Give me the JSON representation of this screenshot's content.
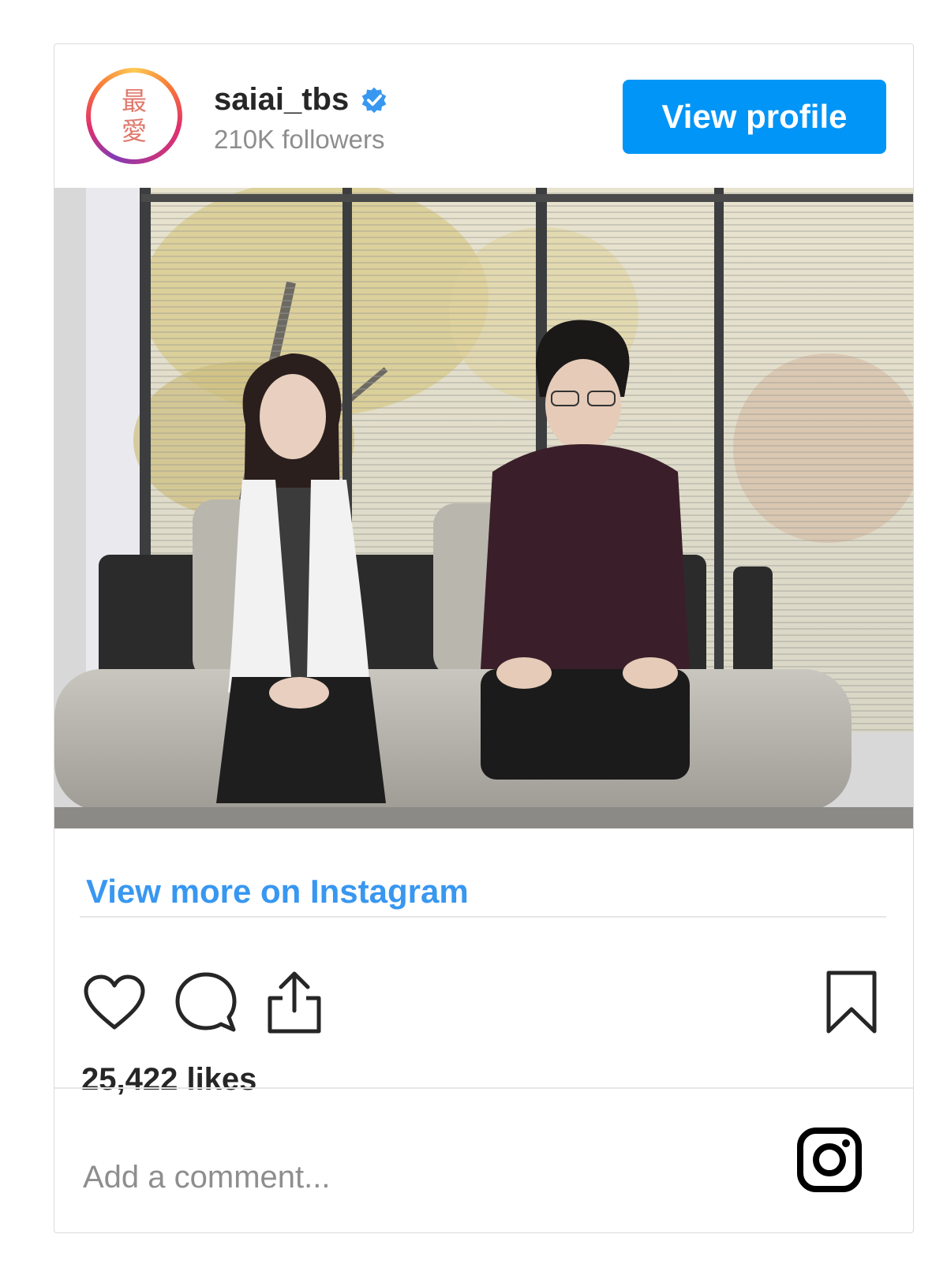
{
  "header": {
    "avatar_text": [
      "最",
      "愛"
    ],
    "username": "saiai_tbs",
    "followers": "210K followers",
    "view_profile_label": "View profile"
  },
  "post": {
    "view_more_label": "View more on Instagram",
    "likes": "25,422 likes",
    "comment_placeholder": "Add a comment..."
  },
  "icons": {
    "verified": "verified-badge-icon",
    "like": "heart-icon",
    "comment": "comment-bubble-icon",
    "share": "share-icon",
    "save": "bookmark-icon",
    "brand": "instagram-icon"
  },
  "colors": {
    "accent": "#0095f6",
    "link": "#3897f0",
    "text": "#262626",
    "muted": "#8e8e8e"
  }
}
